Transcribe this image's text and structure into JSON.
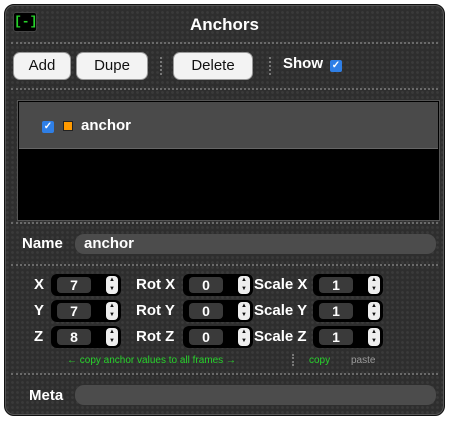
{
  "header": {
    "collapse_label": "[-]",
    "title": "Anchors"
  },
  "toolbar": {
    "add_label": "Add",
    "dupe_label": "Dupe",
    "delete_label": "Delete",
    "show_label": "Show",
    "show_checked": true
  },
  "anchor_list": {
    "items": [
      {
        "name": "anchor",
        "checked": true,
        "swatch_color": "#ff9a00"
      }
    ]
  },
  "name_field": {
    "label": "Name",
    "value": "anchor"
  },
  "transform": {
    "x_label": "X",
    "x_value": "7",
    "y_label": "Y",
    "y_value": "7",
    "z_label": "Z",
    "z_value": "8",
    "rotx_label": "Rot X",
    "rotx_value": "0",
    "roty_label": "Rot Y",
    "roty_value": "0",
    "rotz_label": "Rot Z",
    "rotz_value": "0",
    "scalex_label": "Scale X",
    "scalex_value": "1",
    "scaley_label": "Scale Y",
    "scaley_value": "1",
    "scalez_label": "Scale Z",
    "scalez_value": "1"
  },
  "copy_row": {
    "note": "← copy anchor values to all frames →",
    "copy_label": "copy",
    "paste_label": "paste"
  },
  "meta_field": {
    "label": "Meta",
    "value": ""
  },
  "colors": {
    "accent_green": "#27d32b",
    "checkbox_blue": "#2f7fe6",
    "panel_bg": "#2e2e2e"
  }
}
